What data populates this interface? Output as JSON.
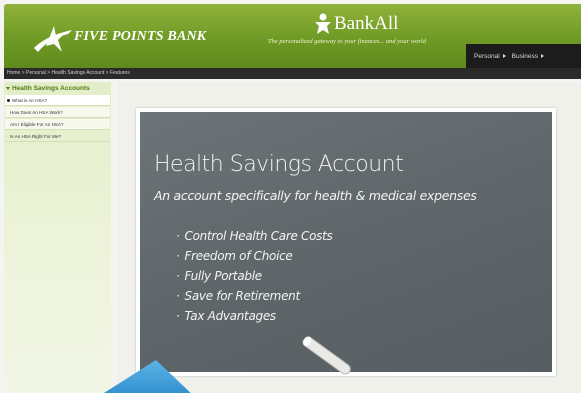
{
  "header": {
    "logo_text": "FIVE POINTS BANK",
    "brand_partner": "BankAll",
    "tagline": "The personalized gateway to your finances... and your world",
    "nav": [
      {
        "label": "Personal"
      },
      {
        "label": "Business"
      }
    ]
  },
  "breadcrumb": "Home > Personal > Health Savings Account > Features",
  "sidebar": {
    "heading": "Health Savings Accounts",
    "items": [
      {
        "label": "What is An HSA?",
        "active": true
      },
      {
        "label": "How Does An HSA Work?",
        "active": false
      },
      {
        "label": "Am I Eligible For An HSA?",
        "active": false
      },
      {
        "label": "Is An HSA Right For Me?",
        "active": false
      }
    ]
  },
  "chalkboard": {
    "title": "Health Savings Account",
    "subtitle": "An account specifically for health & medical expenses",
    "bullets": [
      "Control Health Care Costs",
      "Freedom of Choice",
      "Fully Portable",
      "Save for Retirement",
      "Tax Advantages"
    ]
  },
  "colors": {
    "header_green": "#7aa42c",
    "nav_dark": "#1c1c1c",
    "sidebar_bg": "#e8f0d2",
    "chalkboard": "#636a6e",
    "accent_blue": "#3f9fd8"
  }
}
